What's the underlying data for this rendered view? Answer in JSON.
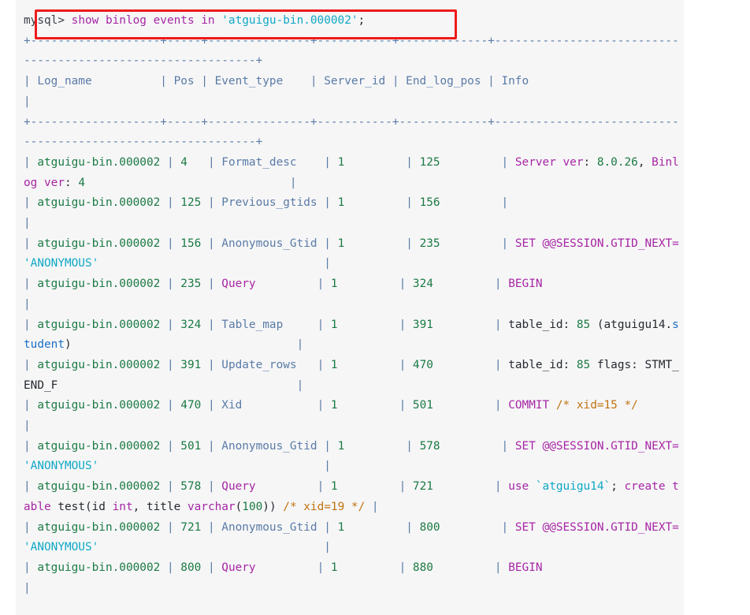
{
  "window": {
    "background_color": "#ffffff",
    "code_block_background": "#f6f6f7"
  },
  "highlight": {
    "color": "#ee1b1b",
    "target": "mysql-command-line"
  },
  "colors": {
    "keyword": "#a626a4",
    "string": "#0fa8c4",
    "number": "#1b7a43",
    "table_border": "#5a7ba6",
    "comment": "#c0730f",
    "identifier_blue": "#1a6fc4",
    "plain": "#24292f"
  },
  "terminal": {
    "prompt": "mysql>",
    "command": "show binlog events in 'atguigu-bin.000002';",
    "command_tokens": [
      {
        "t": "mysql> ",
        "c": "prompt"
      },
      {
        "t": "show binlog events in ",
        "c": "kw"
      },
      {
        "t": "'atguigu-bin.000002'",
        "c": "str"
      },
      {
        "t": ";",
        "c": "plain"
      }
    ],
    "separator_line": "+-------------------+-----+---------------+-----------+-------------+-------------------------------------------------------------+",
    "headers": [
      "Log_name",
      "Pos",
      "Event_type",
      "Server_id",
      "End_log_pos",
      "Info"
    ],
    "header_line": "| Log_name          | Pos | Event_type    | Server_id | End_log_pos | Info                                                          |",
    "rows": [
      {
        "log_name": "atguigu-bin.000002",
        "pos": "4",
        "event_type": "Format_desc",
        "server_id": "1",
        "end_log_pos": "125",
        "info": "Server ver: 8.0.26, Binlog ver: 4"
      },
      {
        "log_name": "atguigu-bin.000002",
        "pos": "125",
        "event_type": "Previous_gtids",
        "server_id": "1",
        "end_log_pos": "156",
        "info": ""
      },
      {
        "log_name": "atguigu-bin.000002",
        "pos": "156",
        "event_type": "Anonymous_Gtid",
        "server_id": "1",
        "end_log_pos": "235",
        "info": "SET @@SESSION.GTID_NEXT= 'ANONYMOUS'"
      },
      {
        "log_name": "atguigu-bin.000002",
        "pos": "235",
        "event_type": "Query",
        "server_id": "1",
        "end_log_pos": "324",
        "info": "BEGIN"
      },
      {
        "log_name": "atguigu-bin.000002",
        "pos": "324",
        "event_type": "Table_map",
        "server_id": "1",
        "end_log_pos": "391",
        "info": "table_id: 85 (atguigu14.student)"
      },
      {
        "log_name": "atguigu-bin.000002",
        "pos": "391",
        "event_type": "Update_rows",
        "server_id": "1",
        "end_log_pos": "470",
        "info": "table_id: 85 flags: STMT_END_F"
      },
      {
        "log_name": "atguigu-bin.000002",
        "pos": "470",
        "event_type": "Xid",
        "server_id": "1",
        "end_log_pos": "501",
        "info": "COMMIT /* xid=15 */"
      },
      {
        "log_name": "atguigu-bin.000002",
        "pos": "501",
        "event_type": "Anonymous_Gtid",
        "server_id": "1",
        "end_log_pos": "578",
        "info": "SET @@SESSION.GTID_NEXT= 'ANONYMOUS'"
      },
      {
        "log_name": "atguigu-bin.000002",
        "pos": "578",
        "event_type": "Query",
        "server_id": "1",
        "end_log_pos": "721",
        "info": "use `atguigu14`; create table test(id int, title varchar(100)) /* xid=19 */"
      },
      {
        "log_name": "atguigu-bin.000002",
        "pos": "721",
        "event_type": "Anonymous_Gtid",
        "server_id": "1",
        "end_log_pos": "800",
        "info": "SET @@SESSION.GTID_NEXT= 'ANONYMOUS'"
      },
      {
        "log_name": "atguigu-bin.000002",
        "pos": "800",
        "event_type": "Query",
        "server_id": "1",
        "end_log_pos": "880",
        "info": "BEGIN"
      }
    ],
    "lines": [
      {
        "id": "command",
        "tokens": [
          {
            "t": "mysql> ",
            "c": "prompt"
          },
          {
            "t": "show binlog events in ",
            "c": "kw"
          },
          {
            "t": "'atguigu-bin.000002'",
            "c": "str"
          },
          {
            "t": ";",
            "c": "plain"
          }
        ]
      },
      {
        "id": "separator-top",
        "tokens": [
          {
            "t": "+-------------------+-----+---------------+-----------+-------------+-------------------------------------------------------------+",
            "c": "tbl"
          }
        ]
      },
      {
        "id": "header",
        "tokens": [
          {
            "t": "| Log_name          | Pos | Event_type    | Server_id | End_log_pos | Info                                                          |",
            "c": "tbl"
          }
        ]
      },
      {
        "id": "separator-mid",
        "tokens": [
          {
            "t": "+-------------------+-----+---------------+-----------+-------------+-------------------------------------------------------------+",
            "c": "tbl"
          }
        ]
      },
      {
        "id": "row-1",
        "tokens": [
          {
            "t": "| ",
            "c": "tbl"
          },
          {
            "t": "atguigu-bin.000002",
            "c": "num"
          },
          {
            "t": " | ",
            "c": "tbl"
          },
          {
            "t": "4",
            "c": "num"
          },
          {
            "t": "   | ",
            "c": "tbl"
          },
          {
            "t": "Format_desc",
            "c": "tbl"
          },
          {
            "t": "    | ",
            "c": "tbl"
          },
          {
            "t": "1",
            "c": "num"
          },
          {
            "t": "         | ",
            "c": "tbl"
          },
          {
            "t": "125",
            "c": "num"
          },
          {
            "t": "         | ",
            "c": "tbl"
          },
          {
            "t": "Server ver",
            "c": "kw"
          },
          {
            "t": ": ",
            "c": "plain"
          },
          {
            "t": "8.0.26",
            "c": "num"
          },
          {
            "t": ", ",
            "c": "plain"
          },
          {
            "t": "Binlog ver",
            "c": "kw"
          },
          {
            "t": ": ",
            "c": "plain"
          },
          {
            "t": "4",
            "c": "num"
          },
          {
            "t": "                              |",
            "c": "tbl"
          }
        ]
      },
      {
        "id": "row-2",
        "tokens": [
          {
            "t": "| ",
            "c": "tbl"
          },
          {
            "t": "atguigu-bin.000002",
            "c": "num"
          },
          {
            "t": " | ",
            "c": "tbl"
          },
          {
            "t": "125",
            "c": "num"
          },
          {
            "t": " | ",
            "c": "tbl"
          },
          {
            "t": "Previous_gtids",
            "c": "tbl"
          },
          {
            "t": " | ",
            "c": "tbl"
          },
          {
            "t": "1",
            "c": "num"
          },
          {
            "t": "         | ",
            "c": "tbl"
          },
          {
            "t": "156",
            "c": "num"
          },
          {
            "t": "         |",
            "c": "tbl"
          },
          {
            "t": "                                                             |",
            "c": "tbl"
          }
        ]
      },
      {
        "id": "row-3",
        "tokens": [
          {
            "t": "| ",
            "c": "tbl"
          },
          {
            "t": "atguigu-bin.000002",
            "c": "num"
          },
          {
            "t": " | ",
            "c": "tbl"
          },
          {
            "t": "156",
            "c": "num"
          },
          {
            "t": " | ",
            "c": "tbl"
          },
          {
            "t": "Anonymous_Gtid",
            "c": "tbl"
          },
          {
            "t": " | ",
            "c": "tbl"
          },
          {
            "t": "1",
            "c": "num"
          },
          {
            "t": "         | ",
            "c": "tbl"
          },
          {
            "t": "235",
            "c": "num"
          },
          {
            "t": "         | ",
            "c": "tbl"
          },
          {
            "t": "SET @@SESSION.GTID_NEXT= ",
            "c": "kw"
          },
          {
            "t": "'ANONYMOUS'",
            "c": "str"
          },
          {
            "t": "                                 |",
            "c": "tbl"
          }
        ]
      },
      {
        "id": "row-4",
        "tokens": [
          {
            "t": "| ",
            "c": "tbl"
          },
          {
            "t": "atguigu-bin.000002",
            "c": "num"
          },
          {
            "t": " | ",
            "c": "tbl"
          },
          {
            "t": "235",
            "c": "num"
          },
          {
            "t": " | ",
            "c": "tbl"
          },
          {
            "t": "Query",
            "c": "kw"
          },
          {
            "t": "         | ",
            "c": "tbl"
          },
          {
            "t": "1",
            "c": "num"
          },
          {
            "t": "         | ",
            "c": "tbl"
          },
          {
            "t": "324",
            "c": "num"
          },
          {
            "t": "         | ",
            "c": "tbl"
          },
          {
            "t": "BEGIN",
            "c": "kw"
          },
          {
            "t": "                                                         |",
            "c": "tbl"
          }
        ]
      },
      {
        "id": "row-5",
        "tokens": [
          {
            "t": "| ",
            "c": "tbl"
          },
          {
            "t": "atguigu-bin.000002",
            "c": "num"
          },
          {
            "t": " | ",
            "c": "tbl"
          },
          {
            "t": "324",
            "c": "num"
          },
          {
            "t": " | ",
            "c": "tbl"
          },
          {
            "t": "Table_map",
            "c": "tbl"
          },
          {
            "t": "     | ",
            "c": "tbl"
          },
          {
            "t": "1",
            "c": "num"
          },
          {
            "t": "         | ",
            "c": "tbl"
          },
          {
            "t": "391",
            "c": "num"
          },
          {
            "t": "         | ",
            "c": "tbl"
          },
          {
            "t": "table_id: ",
            "c": "plain"
          },
          {
            "t": "85",
            "c": "num"
          },
          {
            "t": " (atguigu14.",
            "c": "plain"
          },
          {
            "t": "student",
            "c": "blue"
          },
          {
            "t": ")",
            "c": "plain"
          },
          {
            "t": "                                 |",
            "c": "tbl"
          }
        ]
      },
      {
        "id": "row-6",
        "tokens": [
          {
            "t": "| ",
            "c": "tbl"
          },
          {
            "t": "atguigu-bin.000002",
            "c": "num"
          },
          {
            "t": " | ",
            "c": "tbl"
          },
          {
            "t": "391",
            "c": "num"
          },
          {
            "t": " | ",
            "c": "tbl"
          },
          {
            "t": "Update_rows",
            "c": "tbl"
          },
          {
            "t": "   | ",
            "c": "tbl"
          },
          {
            "t": "1",
            "c": "num"
          },
          {
            "t": "         | ",
            "c": "tbl"
          },
          {
            "t": "470",
            "c": "num"
          },
          {
            "t": "         | ",
            "c": "tbl"
          },
          {
            "t": "table_id: ",
            "c": "plain"
          },
          {
            "t": "85",
            "c": "num"
          },
          {
            "t": " flags: STMT_END_F",
            "c": "plain"
          },
          {
            "t": "                                   |",
            "c": "tbl"
          }
        ]
      },
      {
        "id": "row-7",
        "tokens": [
          {
            "t": "| ",
            "c": "tbl"
          },
          {
            "t": "atguigu-bin.000002",
            "c": "num"
          },
          {
            "t": " | ",
            "c": "tbl"
          },
          {
            "t": "470",
            "c": "num"
          },
          {
            "t": " | ",
            "c": "tbl"
          },
          {
            "t": "Xid",
            "c": "tbl"
          },
          {
            "t": "           | ",
            "c": "tbl"
          },
          {
            "t": "1",
            "c": "num"
          },
          {
            "t": "         | ",
            "c": "tbl"
          },
          {
            "t": "501",
            "c": "num"
          },
          {
            "t": "         | ",
            "c": "tbl"
          },
          {
            "t": "COMMIT ",
            "c": "kw"
          },
          {
            "t": "/* xid=15 */",
            "c": "com"
          },
          {
            "t": "                                           |",
            "c": "tbl"
          }
        ]
      },
      {
        "id": "row-8",
        "tokens": [
          {
            "t": "| ",
            "c": "tbl"
          },
          {
            "t": "atguigu-bin.000002",
            "c": "num"
          },
          {
            "t": " | ",
            "c": "tbl"
          },
          {
            "t": "501",
            "c": "num"
          },
          {
            "t": " | ",
            "c": "tbl"
          },
          {
            "t": "Anonymous_Gtid",
            "c": "tbl"
          },
          {
            "t": " | ",
            "c": "tbl"
          },
          {
            "t": "1",
            "c": "num"
          },
          {
            "t": "         | ",
            "c": "tbl"
          },
          {
            "t": "578",
            "c": "num"
          },
          {
            "t": "         | ",
            "c": "tbl"
          },
          {
            "t": "SET @@SESSION.GTID_NEXT= ",
            "c": "kw"
          },
          {
            "t": "'ANONYMOUS'",
            "c": "str"
          },
          {
            "t": "                                 |",
            "c": "tbl"
          }
        ]
      },
      {
        "id": "row-9",
        "tokens": [
          {
            "t": "| ",
            "c": "tbl"
          },
          {
            "t": "atguigu-bin.000002",
            "c": "num"
          },
          {
            "t": " | ",
            "c": "tbl"
          },
          {
            "t": "578",
            "c": "num"
          },
          {
            "t": " | ",
            "c": "tbl"
          },
          {
            "t": "Query",
            "c": "kw"
          },
          {
            "t": "         | ",
            "c": "tbl"
          },
          {
            "t": "1",
            "c": "num"
          },
          {
            "t": "         | ",
            "c": "tbl"
          },
          {
            "t": "721",
            "c": "num"
          },
          {
            "t": "         | ",
            "c": "tbl"
          },
          {
            "t": "use ",
            "c": "kw"
          },
          {
            "t": "`atguigu14`",
            "c": "str"
          },
          {
            "t": "; ",
            "c": "plain"
          },
          {
            "t": "create table ",
            "c": "kw"
          },
          {
            "t": "test(id ",
            "c": "plain"
          },
          {
            "t": "int",
            "c": "kw"
          },
          {
            "t": ", title ",
            "c": "plain"
          },
          {
            "t": "varchar",
            "c": "kw"
          },
          {
            "t": "(",
            "c": "plain"
          },
          {
            "t": "100",
            "c": "num"
          },
          {
            "t": ")) ",
            "c": "plain"
          },
          {
            "t": "/* xid=19 */",
            "c": "com"
          },
          {
            "t": " |",
            "c": "tbl"
          }
        ]
      },
      {
        "id": "row-10",
        "tokens": [
          {
            "t": "| ",
            "c": "tbl"
          },
          {
            "t": "atguigu-bin.000002",
            "c": "num"
          },
          {
            "t": " | ",
            "c": "tbl"
          },
          {
            "t": "721",
            "c": "num"
          },
          {
            "t": " | ",
            "c": "tbl"
          },
          {
            "t": "Anonymous_Gtid",
            "c": "tbl"
          },
          {
            "t": " | ",
            "c": "tbl"
          },
          {
            "t": "1",
            "c": "num"
          },
          {
            "t": "         | ",
            "c": "tbl"
          },
          {
            "t": "800",
            "c": "num"
          },
          {
            "t": "         | ",
            "c": "tbl"
          },
          {
            "t": "SET @@SESSION.GTID_NEXT= ",
            "c": "kw"
          },
          {
            "t": "'ANONYMOUS'",
            "c": "str"
          },
          {
            "t": "                                 |",
            "c": "tbl"
          }
        ]
      },
      {
        "id": "row-11",
        "tokens": [
          {
            "t": "| ",
            "c": "tbl"
          },
          {
            "t": "atguigu-bin.000002",
            "c": "num"
          },
          {
            "t": " | ",
            "c": "tbl"
          },
          {
            "t": "800",
            "c": "num"
          },
          {
            "t": " | ",
            "c": "tbl"
          },
          {
            "t": "Query",
            "c": "kw"
          },
          {
            "t": "         | ",
            "c": "tbl"
          },
          {
            "t": "1",
            "c": "num"
          },
          {
            "t": "         | ",
            "c": "tbl"
          },
          {
            "t": "880",
            "c": "num"
          },
          {
            "t": "         | ",
            "c": "tbl"
          },
          {
            "t": "BEGIN",
            "c": "kw"
          },
          {
            "t": "                                                         |",
            "c": "tbl"
          }
        ]
      }
    ]
  }
}
